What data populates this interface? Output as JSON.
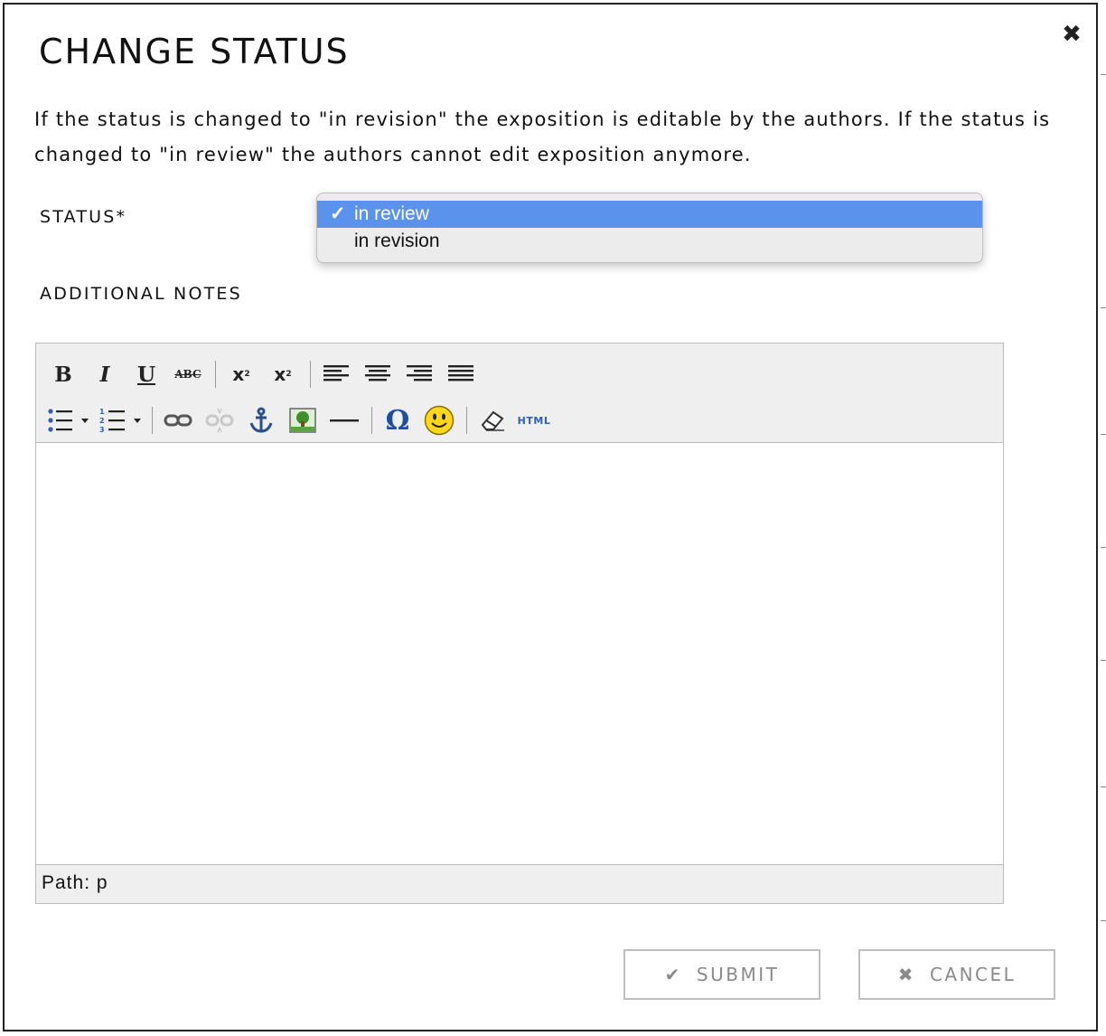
{
  "dialog": {
    "title": "CHANGE STATUS",
    "close_icon": "close-icon",
    "description": "If the status is changed to \"in revision\" the exposition is editable by the authors. If the status is changed to \"in review\" the authors cannot edit exposition anymore."
  },
  "form": {
    "status_label": "STATUS*",
    "notes_label": "ADDITIONAL NOTES"
  },
  "status_dropdown": {
    "check_mark": "✓",
    "options": [
      {
        "label": "in review",
        "selected": true
      },
      {
        "label": "in revision",
        "selected": false
      }
    ],
    "highlight_color": "#5b93ec"
  },
  "editor": {
    "toolbar_row1": [
      "bold-icon",
      "italic-icon",
      "underline-icon",
      "strikethrough-icon",
      "subscript-icon",
      "superscript-icon",
      "align-left-icon",
      "align-center-icon",
      "align-right-icon",
      "align-justify-icon"
    ],
    "toolbar_row2": [
      "bullet-list-icon",
      "numbered-list-icon",
      "link-icon",
      "unlink-icon",
      "anchor-icon",
      "image-icon",
      "horizontal-rule-icon",
      "special-char-icon",
      "emoticon-icon",
      "clean-format-icon",
      "html-source-icon"
    ],
    "html_label": "HTML",
    "path_text": "Path: p"
  },
  "buttons": {
    "submit_label": "SUBMIT",
    "cancel_label": "CANCEL"
  }
}
